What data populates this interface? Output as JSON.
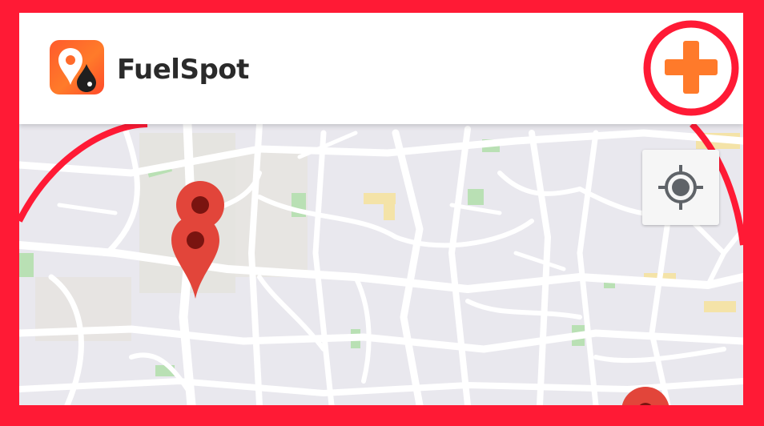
{
  "app": {
    "title": "FuelSpot",
    "logo_icon": "fuel-location-logo-icon"
  },
  "toolbar": {
    "add_icon": "plus-icon",
    "add_color": "#ff7a2a",
    "highlight_color": "#ff1a35"
  },
  "map": {
    "locate_icon": "crosshair-location-icon",
    "marker_icon": "map-pin-icon",
    "marker_color": "#e2453a",
    "marker_count": 3,
    "road_color": "#ffffff",
    "land_color": "#e9e8ee",
    "park_color": "#a9dba6"
  }
}
